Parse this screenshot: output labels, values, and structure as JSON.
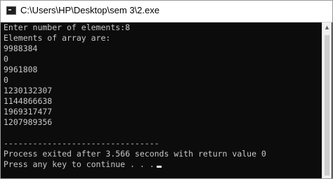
{
  "window": {
    "title": "C:\\Users\\HP\\Desktop\\sem 3\\2.exe",
    "icon": "console-app-icon"
  },
  "console": {
    "lines": [
      "Enter number of elements:8",
      "Elements of array are:",
      "9988384",
      "0",
      "9961808",
      "0",
      "1230132307",
      "1144866638",
      "1969317477",
      "1207989356",
      "",
      "--------------------------------",
      "Process exited after 3.566 seconds with return value 0",
      "Press any key to continue . . ."
    ]
  },
  "colors": {
    "console_background": "#0c0c0c",
    "console_text": "#c8c8c8",
    "titlebar_background": "#ffffff"
  }
}
